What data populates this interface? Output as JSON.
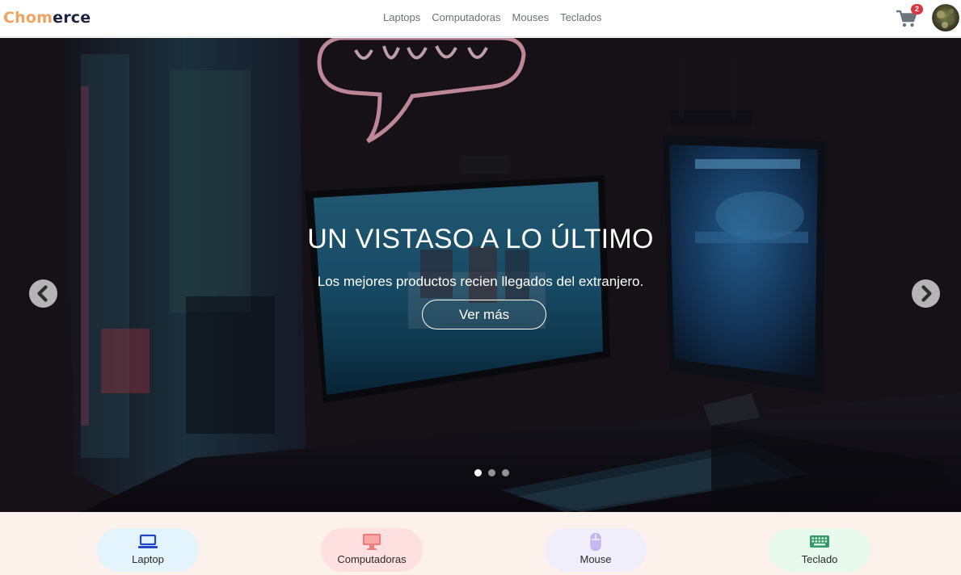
{
  "brand": {
    "part1": "Chom",
    "part2": "erce"
  },
  "nav": {
    "links": [
      "Laptops",
      "Computadoras",
      "Mouses",
      "Teclados"
    ]
  },
  "cart": {
    "count": "2",
    "icon": "cart-icon"
  },
  "avatar": {
    "icon": "user-avatar"
  },
  "hero": {
    "title": "UN VISTASO A LO ÚLTIMO",
    "subtitle": "Los mejores productos recien llegados del extranjero.",
    "button": "Ver más",
    "slides": 3,
    "active_slide": 1
  },
  "categories": [
    {
      "label": "Laptop",
      "icon": "laptop-icon",
      "bg": "#e4f4fd",
      "color": "#2346c8"
    },
    {
      "label": "Computadoras",
      "icon": "monitor-icon",
      "bg": "#fde0df",
      "color": "#f07b78"
    },
    {
      "label": "Mouse",
      "icon": "mouse-icon",
      "bg": "#f1eefb",
      "color": "#b7a6ea"
    },
    {
      "label": "Teclado",
      "icon": "keyboard-icon",
      "bg": "#e8f9ee",
      "color": "#37986a"
    }
  ],
  "colors": {
    "brand_orange": "#f0a35c",
    "brand_dark": "#1c2340",
    "badge": "#dc3545"
  }
}
